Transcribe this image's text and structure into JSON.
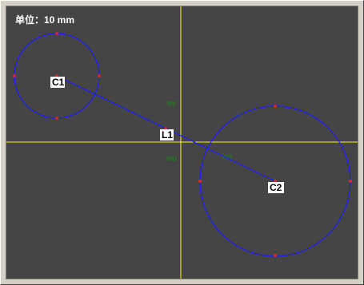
{
  "unit_label": "单位：10 mm",
  "axes": {
    "color": "#ffff00",
    "labels": {
      "wy": "wy",
      "wx": "wx",
      "wo": "wo"
    },
    "label_color": "#1a8a1a"
  },
  "colors": {
    "background": "#454545",
    "geometry": "#1c1cff",
    "points": "#ff2020",
    "tag_bg": "#ffffff",
    "tag_text": "#000000"
  },
  "entities": {
    "c1": {
      "label": "C1",
      "type": "circle"
    },
    "c2": {
      "label": "C2",
      "type": "circle"
    },
    "l1": {
      "label": "L1",
      "type": "line",
      "from": "C1",
      "to": "C2"
    }
  }
}
